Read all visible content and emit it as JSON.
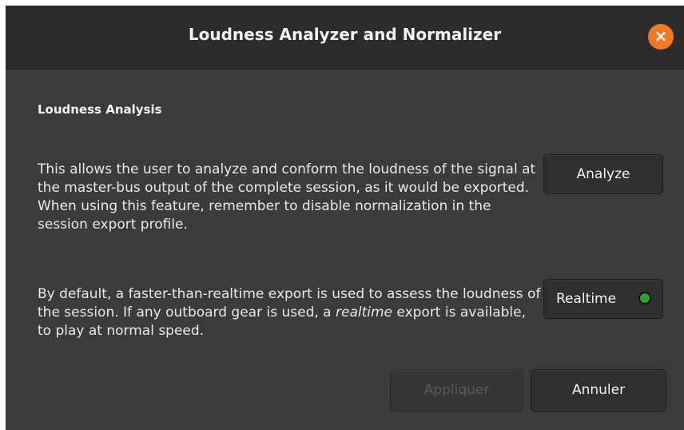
{
  "window": {
    "title": "Loudness Analyzer and Normalizer",
    "close_icon": "close-icon",
    "close_glyph": "×",
    "accent_color": "#f07a24"
  },
  "section": {
    "heading": "Loudness Analysis",
    "paragraph1": "This allows the user to analyze and conform the loudness of the signal at the master-bus output of the complete session, as it would be exported. When using this feature, remember to disable normalization in the session export profile.",
    "paragraph2_before": "By default, a faster-than-realtime export is used to assess the loudness of the session. If any outboard gear is used, a ",
    "paragraph2_emphasis": "realtime",
    "paragraph2_after": " export is available, to play at normal speed."
  },
  "buttons": {
    "analyze": "Analyze",
    "realtime": "Realtime",
    "realtime_led_color": "#29a329",
    "apply": "Appliquer",
    "cancel": "Annuler"
  }
}
